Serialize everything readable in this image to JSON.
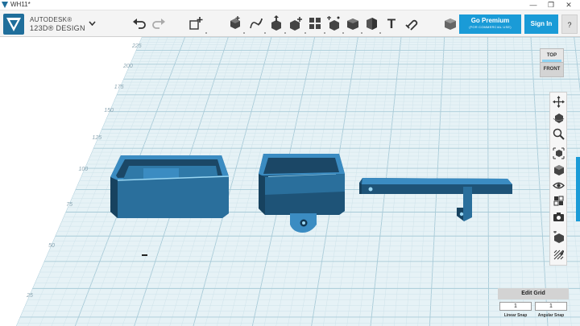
{
  "window": {
    "title": "WH11*",
    "minimize": "—",
    "maximize": "❐",
    "close": "✕"
  },
  "brand": {
    "line1": "AUTODESK®",
    "line2": "123D® DESIGN"
  },
  "toolbar": {
    "icons": [
      "undo-icon",
      "redo-icon",
      "transform-icon",
      "primitives-icon",
      "sketch-icon",
      "construct-icon",
      "modify-icon",
      "pattern-icon",
      "grouping-icon",
      "combine-icon",
      "measure-icon",
      "text-icon",
      "snap-icon",
      "material-icon"
    ],
    "text_tool_glyph": "T"
  },
  "premium": {
    "title": "Go Premium",
    "subtitle": "(FOR COMMERCIAL USE)"
  },
  "signin_label": "Sign In",
  "help_label": "?",
  "viewcube": {
    "top": "TOP",
    "front": "FRONT"
  },
  "grid": {
    "ruler_labels": [
      "225",
      "200",
      "175",
      "150",
      "125",
      "100",
      "75",
      "50",
      "25"
    ],
    "colors": {
      "background": "#e6f2f6",
      "minor": "#cfe3ea",
      "major": "#a9cbd8",
      "model": "#3a88bd",
      "model_dark": "#1d4f73",
      "model_light": "#9ad7f3"
    }
  },
  "nav_tools": [
    "pan-icon",
    "orbit-icon",
    "zoom-icon",
    "fit-icon",
    "view-cube-icon",
    "visibility-icon",
    "materials-icon",
    "screenshot-icon",
    "solid-view-icon",
    "edit-grid-icon"
  ],
  "edit_grid": {
    "title": "Edit Grid",
    "linear_value": "1",
    "angular_value": "1",
    "linear_label": "Linear Snap",
    "angular_label": "Angular Snap"
  }
}
